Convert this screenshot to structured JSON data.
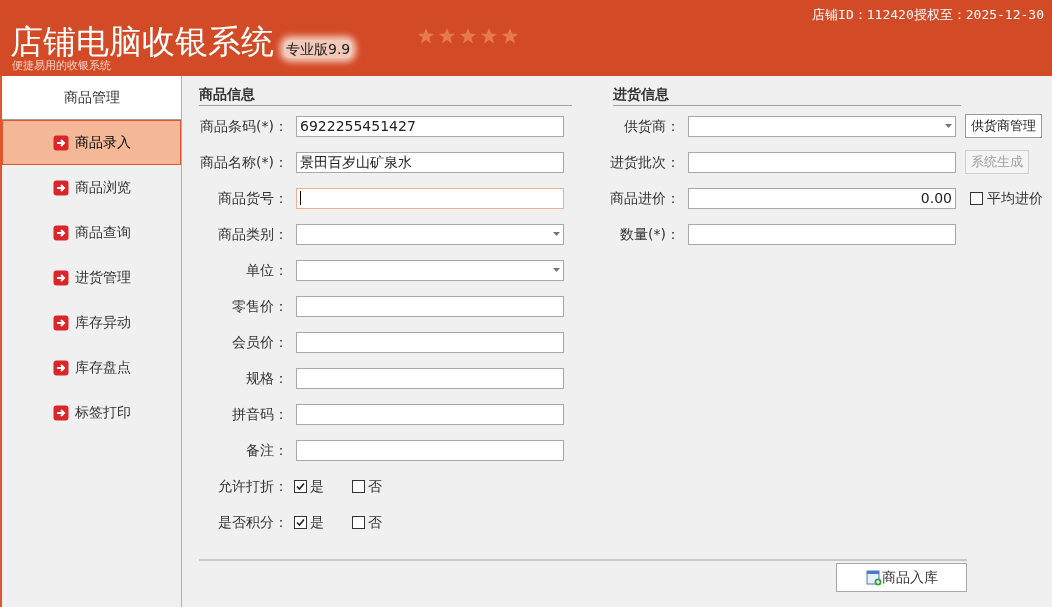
{
  "header": {
    "title": "店铺电脑收银系统",
    "edition": "专业版9.9",
    "subtitle": "便捷易用的收银系统",
    "license": "店铺ID：112420授权至：2025-12-30"
  },
  "sidebar": {
    "heading": "商品管理",
    "items": [
      {
        "label": "商品录入",
        "selected": true
      },
      {
        "label": "商品浏览",
        "selected": false
      },
      {
        "label": "商品查询",
        "selected": false
      },
      {
        "label": "进货管理",
        "selected": false
      },
      {
        "label": "库存异动",
        "selected": false
      },
      {
        "label": "库存盘点",
        "selected": false
      },
      {
        "label": "标签打印",
        "selected": false
      }
    ]
  },
  "product_info": {
    "heading": "商品信息",
    "fields": [
      {
        "kind": "text",
        "label": "商品条码(*)：",
        "value": "6922255451427",
        "focused": false
      },
      {
        "kind": "text",
        "label": "商品名称(*)：",
        "value": "景田百岁山矿泉水",
        "focused": false
      },
      {
        "kind": "text",
        "label": "商品货号：",
        "focused": true
      },
      {
        "kind": "select",
        "label": "商品类别："
      },
      {
        "kind": "select",
        "label": "单位："
      },
      {
        "kind": "text",
        "label": "零售价：",
        "focused": false
      },
      {
        "kind": "text",
        "label": "会员价：",
        "focused": false
      },
      {
        "kind": "text",
        "label": "规格：",
        "focused": false
      },
      {
        "kind": "text",
        "label": "拼音码：",
        "focused": false
      },
      {
        "kind": "text",
        "label": "备注：",
        "focused": false
      },
      {
        "kind": "choice",
        "label": "允许打折：",
        "options": [
          {
            "label": "是",
            "checked": true
          },
          {
            "label": "否",
            "checked": false
          }
        ]
      },
      {
        "kind": "choice",
        "label": "是否积分：",
        "options": [
          {
            "label": "是",
            "checked": true
          },
          {
            "label": "否",
            "checked": false
          }
        ]
      }
    ]
  },
  "purchase_info": {
    "heading": "进货信息",
    "fields": [
      {
        "kind": "select",
        "label": "供货商：",
        "button": {
          "label": "供货商管理",
          "disabled": false
        }
      },
      {
        "kind": "text",
        "label": "进货批次：",
        "button": {
          "label": "系统生成",
          "disabled": true
        }
      },
      {
        "kind": "text",
        "label": "商品进价：",
        "value": "0.00",
        "check": {
          "label": "平均进价",
          "checked": false
        }
      },
      {
        "kind": "text",
        "label": "数量(*)："
      }
    ]
  },
  "submit_button": "商品入库"
}
